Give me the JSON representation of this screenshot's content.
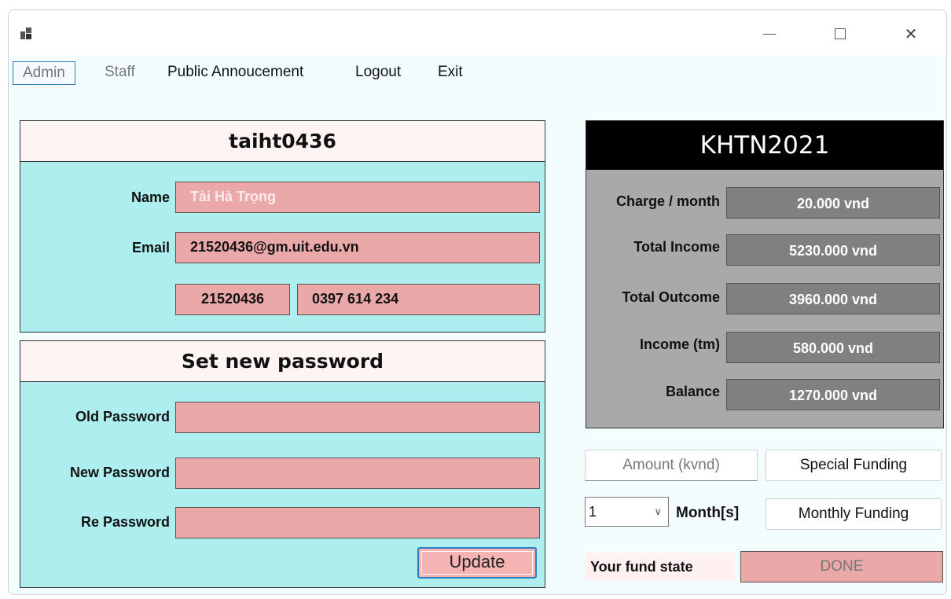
{
  "menu": {
    "admin": "Admin",
    "staff": "Staff",
    "public_announcement": "Public Annoucement",
    "logout": "Logout",
    "exit": "Exit"
  },
  "window_controls": {
    "minimize_icon": "minimize-icon",
    "maximize_icon": "maximize-icon",
    "close_icon": "close-icon",
    "close_glyph": "✕"
  },
  "user": {
    "username": "taiht0436",
    "name_label": "Name",
    "name_value": "Tài Hà Trọng",
    "email_label": "Email",
    "email_value": "21520436@gm.uit.edu.vn",
    "student_id": "21520436",
    "phone": "0397 614 234"
  },
  "password": {
    "title": "Set new password",
    "old_label": "Old Password",
    "new_label": "New Password",
    "re_label": "Re Password",
    "old_value": "",
    "new_value": "",
    "re_value": "",
    "update_label": "Update"
  },
  "fund": {
    "title": "KHTN2021",
    "rows": [
      {
        "label": "Charge / month",
        "value": "20.000 vnd"
      },
      {
        "label": "Total Income",
        "value": "5230.000 vnd"
      },
      {
        "label": "Total Outcome",
        "value": "3960.000 vnd"
      },
      {
        "label": "Income (tm)",
        "value": "580.000 vnd"
      },
      {
        "label": "Balance",
        "value": "1270.000 vnd"
      }
    ]
  },
  "funding": {
    "amount_placeholder": "Amount (kvnd)",
    "special_label": "Special Funding",
    "month_selected": "1",
    "months_label": "Month[s]",
    "monthly_label": "Monthly Funding",
    "state_label": "Your fund state",
    "state_value": "DONE"
  },
  "colors": {
    "field_bg": "#eba8a8",
    "panel_bg": "#afeeee",
    "header_bg": "#fff4f4",
    "fund_bg": "#a9a9a9",
    "fund_value_bg": "#808080",
    "accent": "#2d7fc4"
  }
}
